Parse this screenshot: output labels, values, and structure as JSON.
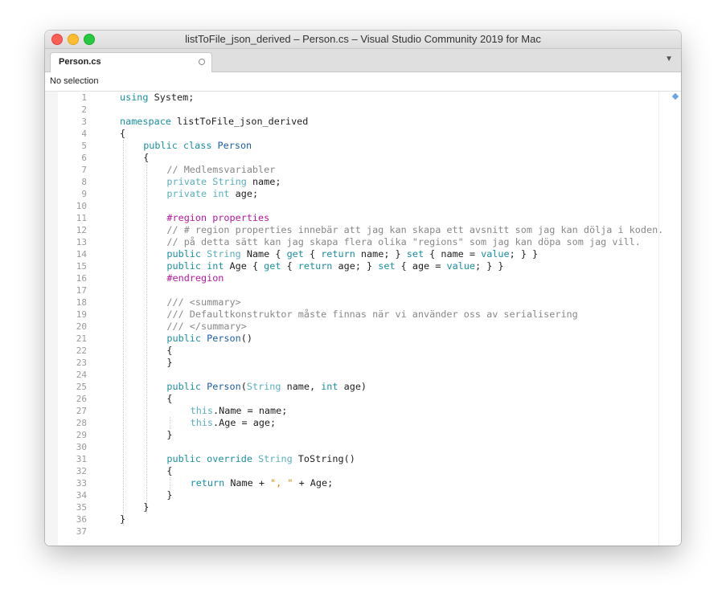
{
  "window": {
    "title": "listToFile_json_derived – Person.cs – Visual Studio Community 2019 for Mac"
  },
  "tabs": [
    {
      "label": "Person.cs"
    }
  ],
  "tab_overflow_icon": "chevron-down-icon",
  "pathbar": {
    "label": "No selection"
  },
  "colors": {
    "keyword": "#1a8fa1",
    "type": "#1d5ea7",
    "comment": "#888888",
    "preprocessor": "#b5179e",
    "string": "#e07b00",
    "plain": "#222222"
  },
  "editor": {
    "lines": [
      {
        "n": "1",
        "indent": 0,
        "tokens": [
          [
            "k",
            "using"
          ],
          [
            "p",
            " System;"
          ]
        ]
      },
      {
        "n": "2",
        "indent": 0,
        "tokens": []
      },
      {
        "n": "3",
        "indent": 0,
        "tokens": [
          [
            "k",
            "namespace"
          ],
          [
            "p",
            " listToFile_json_derived"
          ]
        ]
      },
      {
        "n": "4",
        "indent": 0,
        "tokens": [
          [
            "p",
            "{"
          ]
        ]
      },
      {
        "n": "5",
        "indent": 1,
        "tokens": [
          [
            "k",
            "public"
          ],
          [
            "p",
            " "
          ],
          [
            "k",
            "class"
          ],
          [
            "p",
            " "
          ],
          [
            "t",
            "Person"
          ]
        ]
      },
      {
        "n": "6",
        "indent": 1,
        "tokens": [
          [
            "p",
            "{"
          ]
        ]
      },
      {
        "n": "7",
        "indent": 2,
        "tokens": [
          [
            "c",
            "// Medlemsvariabler"
          ]
        ]
      },
      {
        "n": "8",
        "indent": 2,
        "tokens": [
          [
            "kl",
            "private"
          ],
          [
            "p",
            " "
          ],
          [
            "tl",
            "String"
          ],
          [
            "p",
            " name;"
          ]
        ]
      },
      {
        "n": "9",
        "indent": 2,
        "tokens": [
          [
            "kl",
            "private"
          ],
          [
            "p",
            " "
          ],
          [
            "kl",
            "int"
          ],
          [
            "p",
            " age;"
          ]
        ]
      },
      {
        "n": "10",
        "indent": 0,
        "tokens": []
      },
      {
        "n": "11",
        "indent": 2,
        "tokens": [
          [
            "r",
            "#region properties"
          ]
        ]
      },
      {
        "n": "12",
        "indent": 2,
        "tokens": [
          [
            "c",
            "// # region properties innebär att jag kan skapa ett avsnitt som jag kan dölja i koden."
          ]
        ]
      },
      {
        "n": "13",
        "indent": 2,
        "tokens": [
          [
            "c",
            "// på detta sätt kan jag skapa flera olika \"regions\" som jag kan döpa som jag vill."
          ]
        ]
      },
      {
        "n": "14",
        "indent": 2,
        "tokens": [
          [
            "k",
            "public"
          ],
          [
            "p",
            " "
          ],
          [
            "tl",
            "String"
          ],
          [
            "p",
            " Name { "
          ],
          [
            "k",
            "get"
          ],
          [
            "p",
            " { "
          ],
          [
            "k",
            "return"
          ],
          [
            "p",
            " name; } "
          ],
          [
            "k",
            "set"
          ],
          [
            "p",
            " { name = "
          ],
          [
            "k",
            "value"
          ],
          [
            "p",
            "; } }"
          ]
        ]
      },
      {
        "n": "15",
        "indent": 2,
        "tokens": [
          [
            "k",
            "public"
          ],
          [
            "p",
            " "
          ],
          [
            "k",
            "int"
          ],
          [
            "p",
            " Age { "
          ],
          [
            "k",
            "get"
          ],
          [
            "p",
            " { "
          ],
          [
            "k",
            "return"
          ],
          [
            "p",
            " age; } "
          ],
          [
            "k",
            "set"
          ],
          [
            "p",
            " { age = "
          ],
          [
            "k",
            "value"
          ],
          [
            "p",
            "; } }"
          ]
        ]
      },
      {
        "n": "16",
        "indent": 2,
        "tokens": [
          [
            "r",
            "#endregion"
          ]
        ]
      },
      {
        "n": "17",
        "indent": 0,
        "tokens": []
      },
      {
        "n": "18",
        "indent": 2,
        "tokens": [
          [
            "c",
            "/// <summary>"
          ]
        ]
      },
      {
        "n": "19",
        "indent": 2,
        "tokens": [
          [
            "c",
            "/// Defaultkonstruktor måste finnas när vi använder oss av serialisering"
          ]
        ]
      },
      {
        "n": "20",
        "indent": 2,
        "tokens": [
          [
            "c",
            "/// </summary>"
          ]
        ]
      },
      {
        "n": "21",
        "indent": 2,
        "tokens": [
          [
            "k",
            "public"
          ],
          [
            "p",
            " "
          ],
          [
            "t",
            "Person"
          ],
          [
            "p",
            "()"
          ]
        ]
      },
      {
        "n": "22",
        "indent": 2,
        "tokens": [
          [
            "p",
            "{"
          ]
        ]
      },
      {
        "n": "23",
        "indent": 2,
        "tokens": [
          [
            "p",
            "}"
          ]
        ]
      },
      {
        "n": "24",
        "indent": 0,
        "tokens": []
      },
      {
        "n": "25",
        "indent": 2,
        "tokens": [
          [
            "k",
            "public"
          ],
          [
            "p",
            " "
          ],
          [
            "t",
            "Person"
          ],
          [
            "p",
            "("
          ],
          [
            "tl",
            "String"
          ],
          [
            "p",
            " name, "
          ],
          [
            "k",
            "int"
          ],
          [
            "p",
            " age)"
          ]
        ]
      },
      {
        "n": "26",
        "indent": 2,
        "tokens": [
          [
            "p",
            "{"
          ]
        ]
      },
      {
        "n": "27",
        "indent": 3,
        "tokens": [
          [
            "kl",
            "this"
          ],
          [
            "p",
            ".Name = name;"
          ]
        ]
      },
      {
        "n": "28",
        "indent": 3,
        "tokens": [
          [
            "kl",
            "this"
          ],
          [
            "p",
            ".Age = age;"
          ]
        ]
      },
      {
        "n": "29",
        "indent": 2,
        "tokens": [
          [
            "p",
            "}"
          ]
        ]
      },
      {
        "n": "30",
        "indent": 0,
        "tokens": []
      },
      {
        "n": "31",
        "indent": 2,
        "tokens": [
          [
            "k",
            "public"
          ],
          [
            "p",
            " "
          ],
          [
            "k",
            "override"
          ],
          [
            "p",
            " "
          ],
          [
            "tl",
            "String"
          ],
          [
            "p",
            " ToString()"
          ]
        ]
      },
      {
        "n": "32",
        "indent": 2,
        "tokens": [
          [
            "p",
            "{"
          ]
        ]
      },
      {
        "n": "33",
        "indent": 3,
        "tokens": [
          [
            "k",
            "return"
          ],
          [
            "p",
            " Name + "
          ],
          [
            "s",
            "\", \""
          ],
          [
            "p",
            " + Age;"
          ]
        ]
      },
      {
        "n": "34",
        "indent": 2,
        "tokens": [
          [
            "p",
            "}"
          ]
        ]
      },
      {
        "n": "35",
        "indent": 1,
        "tokens": [
          [
            "p",
            "}"
          ]
        ]
      },
      {
        "n": "36",
        "indent": 0,
        "tokens": [
          [
            "p",
            "}"
          ]
        ]
      },
      {
        "n": "37",
        "indent": 0,
        "tokens": []
      }
    ]
  },
  "overview_marker_icon": "diamond-marker-icon"
}
